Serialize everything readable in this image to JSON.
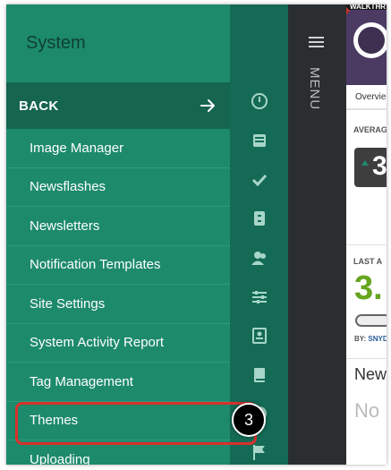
{
  "system_panel": {
    "title": "System",
    "back_label": "BACK",
    "items": [
      {
        "label": "Image Manager"
      },
      {
        "label": "Newsflashes"
      },
      {
        "label": "Newsletters"
      },
      {
        "label": "Notification Templates"
      },
      {
        "label": "Site Settings"
      },
      {
        "label": "System Activity Report"
      },
      {
        "label": "Tag Management"
      },
      {
        "label": "Themes"
      },
      {
        "label": "Uploading"
      }
    ]
  },
  "icon_rail": {
    "icons": [
      "dashboard-icon",
      "inbox-icon",
      "checkmark-icon",
      "cabinet-icon",
      "people-icon",
      "sliders-icon",
      "contact-card-icon",
      "book-icon",
      "globe-icon",
      "flag-icon"
    ]
  },
  "menu_strip": {
    "label": "MENU"
  },
  "content": {
    "walkthrough_label": "WALKTHR",
    "overview_tab": "Overvie",
    "average_label": "AVERAG",
    "average_value": "3",
    "last_label": "LAST A",
    "last_value": "3.",
    "by_label": "BY:",
    "by_name": "SNYD",
    "new_label": "New",
    "no_label": "No"
  },
  "callout": {
    "step_number": "3"
  },
  "colors": {
    "panel_green": "#1d8a6c",
    "back_green": "#15654f",
    "rail_green": "#146a55",
    "menu_dark": "#2b2e30",
    "highlight_red": "#d9302b"
  }
}
